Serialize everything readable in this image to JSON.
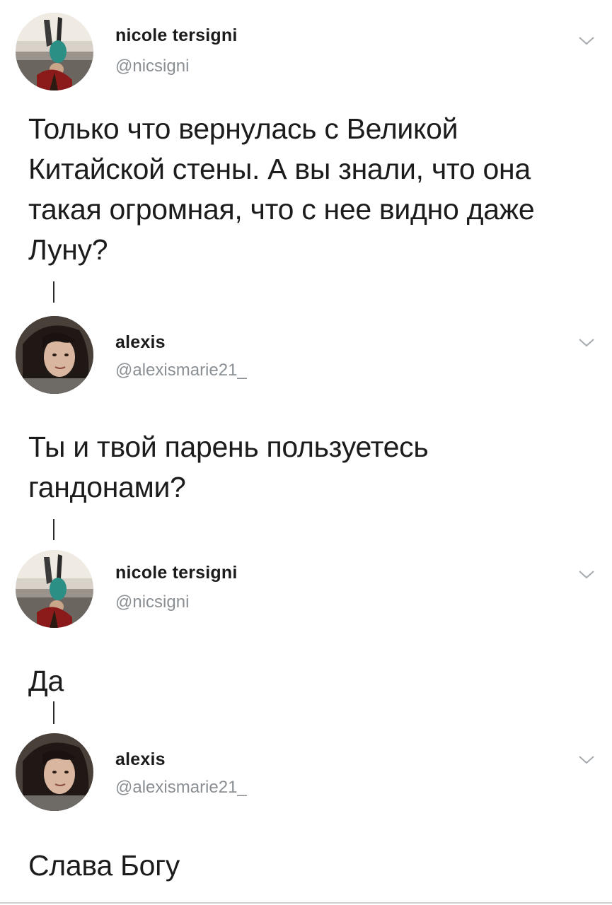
{
  "thread": {
    "tweets": [
      {
        "name": "nicole tersigni",
        "handle": "@nicsigni",
        "text": "Только что вернулась с Великой Китайской стены. А вы знали, что она такая огромная, что с нее видно даже Луну?",
        "avatar_icon": "avatar-photo-nicole"
      },
      {
        "name": "alexis",
        "handle": "@alexismarie21_",
        "text": "Ты и твой парень пользуетесь гандонами?",
        "avatar_icon": "avatar-photo-alexis"
      },
      {
        "name": "nicole tersigni",
        "handle": "@nicsigni",
        "text": "Да",
        "avatar_icon": "avatar-photo-nicole"
      },
      {
        "name": "alexis",
        "handle": "@alexismarie21_",
        "text": "Слава Богу",
        "avatar_icon": "avatar-photo-alexis"
      }
    ]
  },
  "colors": {
    "text": "#1c1c1c",
    "handle": "#8a8f94",
    "chevron": "#a6abb0",
    "connector": "#2a2a2a"
  },
  "icons": {
    "more": "chevron-down-icon"
  }
}
